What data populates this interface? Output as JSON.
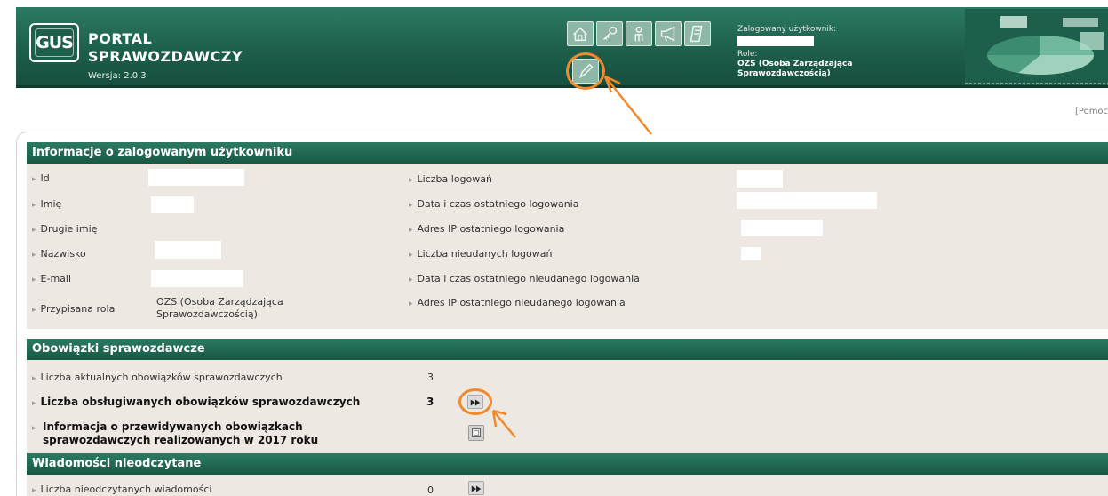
{
  "header": {
    "logo_text": "GUS",
    "title_line1": "PORTAL",
    "title_line2": "SPRAWOZDAWCZY",
    "version": "Wersja: 2.0.3",
    "nav_icons": [
      "home-icon",
      "key-icon",
      "info-person-icon",
      "megaphone-icon",
      "document-icon"
    ],
    "edit_icon": "pencil-icon",
    "user_label": "Zalogowany użytkownik:",
    "role_label": "Role:",
    "role_value": "OZS (Osoba Zarządzająca Sprawozdawczością)"
  },
  "help_link": "[Pomoc]",
  "user_info": {
    "title": "Informacje o zalogowanym użytkowniku",
    "left": [
      {
        "label": "Id",
        "value": ""
      },
      {
        "label": "Imię",
        "value": ""
      },
      {
        "label": "Drugie imię",
        "value": ""
      },
      {
        "label": "Nazwisko",
        "value": ""
      },
      {
        "label": "E-mail",
        "value": ""
      },
      {
        "label": "Przypisana rola",
        "value_line1": "OZS (Osoba Zarządzająca",
        "value_line2": "Sprawozdawczością)"
      }
    ],
    "right": [
      {
        "label": "Liczba logowań"
      },
      {
        "label": "Data i czas ostatniego logowania"
      },
      {
        "label": "Adres IP ostatniego logowania"
      },
      {
        "label": "Liczba nieudanych logowań"
      },
      {
        "label": "Data i czas ostatniego nieudanego logowania"
      },
      {
        "label": "Adres IP ostatniego nieudanego logowania"
      }
    ]
  },
  "obligations": {
    "title": "Obowiązki sprawozdawcze",
    "rows": [
      {
        "label": "Liczba aktualnych obowiązków sprawozdawczych",
        "value": "3"
      },
      {
        "label": "Liczba obsługiwanych obowiązków sprawozdawczych",
        "value": "3"
      },
      {
        "label_line1": "Informacja o przewidywanych obowiązkach",
        "label_line2": "sprawozdawczych realizowanych w 2017 roku"
      }
    ]
  },
  "messages": {
    "title": "Wiadomości nieodczytane",
    "rows": [
      {
        "label": "Liczba nieodczytanych wiadomości",
        "value": "0"
      }
    ]
  },
  "colors": {
    "header_green": "#1d5f4b",
    "section_header": "#185743",
    "row_background": "#ede8e2",
    "annotation_orange": "#f08a2c"
  }
}
